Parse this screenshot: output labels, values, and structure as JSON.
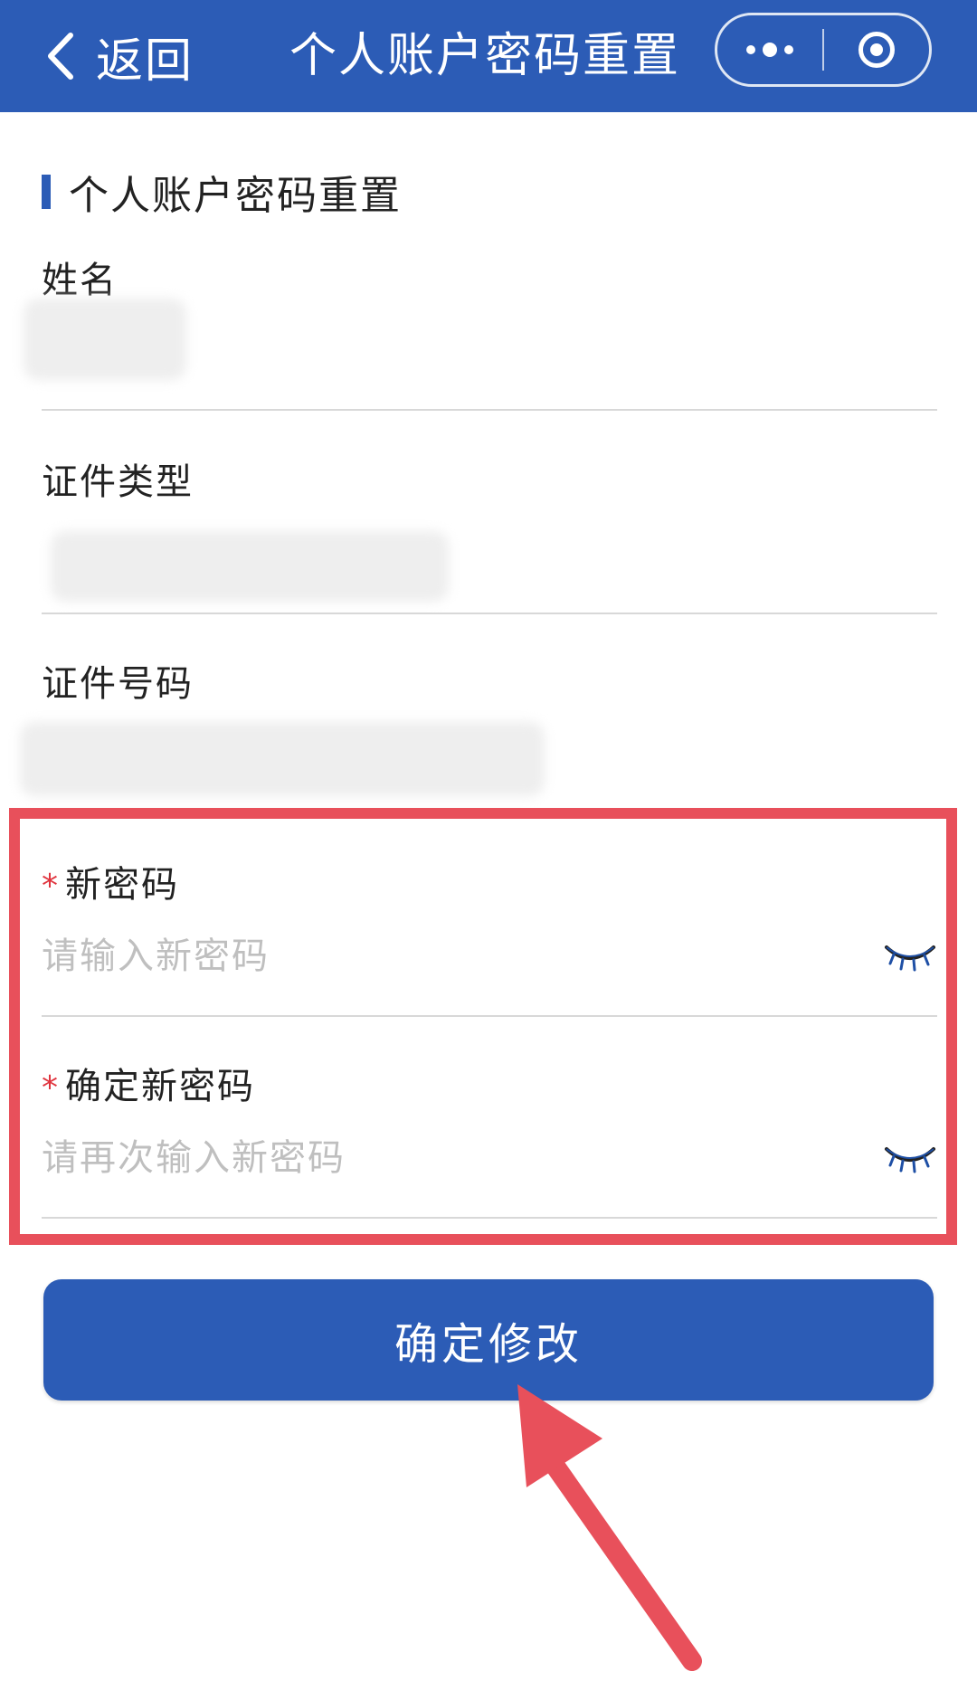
{
  "nav": {
    "back_label": "返回",
    "title": "个人账户密码重置",
    "background_color": "#2c5cb6"
  },
  "section": {
    "title": "个人账户密码重置"
  },
  "fields": {
    "name": {
      "label": "姓名"
    },
    "id_type": {
      "label": "证件类型"
    },
    "id_number": {
      "label": "证件号码"
    },
    "new_password": {
      "label": "新密码",
      "required_mark": "*",
      "placeholder": "请输入新密码",
      "icon": "eye-closed-icon"
    },
    "confirm_password": {
      "label": "确定新密码",
      "required_mark": "*",
      "placeholder": "请再次输入新密码",
      "icon": "eye-closed-icon"
    }
  },
  "submit": {
    "label": "确定修改"
  },
  "colors": {
    "accent": "#2c5cb6",
    "required": "#e0353f",
    "annotation": "#e8505b"
  }
}
